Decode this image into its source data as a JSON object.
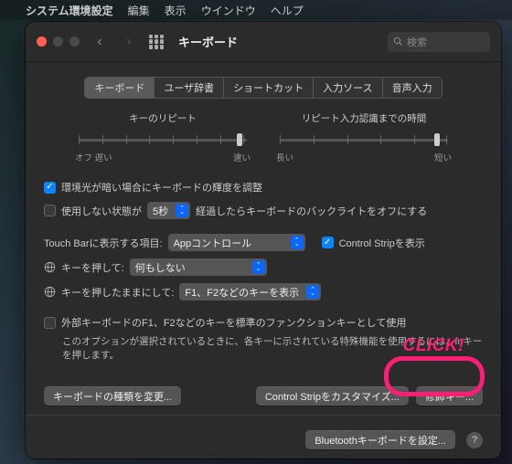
{
  "menubar": {
    "app": "システム環境設定",
    "items": [
      "編集",
      "表示",
      "ウインドウ",
      "ヘルプ"
    ]
  },
  "window": {
    "title": "キーボード",
    "search_placeholder": "検索"
  },
  "tabs": [
    "キーボード",
    "ユーザ辞書",
    "ショートカット",
    "入力ソース",
    "音声入力"
  ],
  "active_tab": 0,
  "sliders": {
    "repeat": {
      "label": "キーのリピート",
      "left": "オフ  遅い",
      "right": "速い",
      "position": 0.95
    },
    "delay": {
      "label": "リピート入力認識までの時間",
      "left": "長い",
      "right": "短い",
      "position": 0.92
    }
  },
  "options": {
    "adjust_brightness": {
      "checked": true,
      "label": "環境光が暗い場合にキーボードの輝度を調整"
    },
    "backlight_off": {
      "checked": false,
      "label_pre": "使用しない状態が",
      "select": "5秒",
      "label_post": "経過したらキーボードのバックライトをオフにする"
    },
    "touchbar": {
      "label": "Touch Barに表示する項目:",
      "select": "Appコントロール",
      "control_strip": {
        "checked": true,
        "label": "Control Stripを表示"
      }
    },
    "globe_press": {
      "label": "キーを押して:",
      "select": "何もしない"
    },
    "globe_hold": {
      "label": "キーを押したままにして:",
      "select": "F1、F2などのキーを表示"
    },
    "external_fn": {
      "checked": false,
      "label": "外部キーボードのF1、F2などのキーを標準のファンクションキーとして使用",
      "hint": "このオプションが選択されているときに、各キーに示されている特殊機能を使用するには、fnキーを押します。"
    }
  },
  "buttons": {
    "change_type": "キーボードの種類を変更...",
    "customize_cs": "Control Stripをカスタマイズ...",
    "modifier": "修飾キー...",
    "bluetooth": "Bluetoothキーボードを設定..."
  },
  "annotation": "CLICK!"
}
